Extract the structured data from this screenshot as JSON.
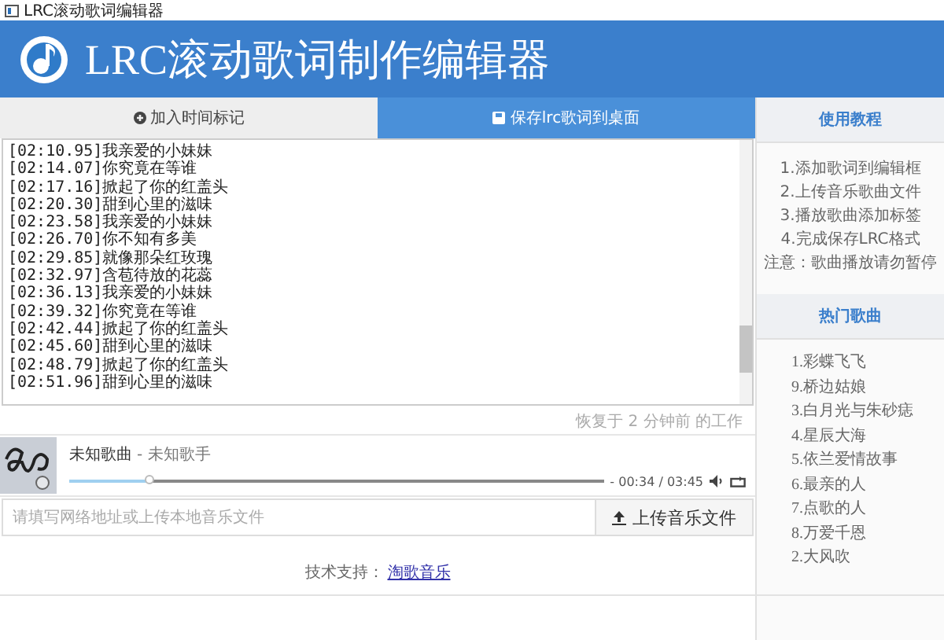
{
  "window": {
    "title": "LRC滚动歌词编辑器"
  },
  "header": {
    "title": "LRC滚动歌词制作编辑器"
  },
  "tabs": [
    {
      "label": "加入时间标记",
      "kind": "add",
      "selected": false
    },
    {
      "label": "保存lrc歌词到桌面",
      "kind": "save",
      "selected": true
    }
  ],
  "lyrics": [
    "[02:10.95]我亲爱的小妹妹",
    "[02:14.07]你究竟在等谁",
    "[02:17.16]掀起了你的红盖头",
    "[02:20.30]甜到心里的滋味",
    "[02:23.58]我亲爱的小妹妹",
    "[02:26.70]你不知有多美",
    "[02:29.85]就像那朵红玫瑰",
    "[02:32.97]含苞待放的花蕊",
    "[02:36.13]我亲爱的小妹妹",
    "[02:39.32]你究竟在等谁",
    "[02:42.44]掀起了你的红盖头",
    "[02:45.60]甜到心里的滋味",
    "[02:48.79]掀起了你的红盖头",
    "[02:51.96]甜到心里的滋味"
  ],
  "restore_note": "恢复于 2 分钟前 的工作",
  "player": {
    "song": "未知歌曲",
    "artist": "- 未知歌手",
    "level": 0.15,
    "time": "- 00:34 / 03:45"
  },
  "upload": {
    "placeholder": "请填写网络地址或上传本地音乐文件",
    "button": "上传音乐文件"
  },
  "footer": {
    "label": "技术支持：",
    "link": "淘歌音乐"
  },
  "sidebar": {
    "tutorial_title": "使用教程",
    "steps": [
      "1.添加歌词到编辑框",
      "2.上传音乐歌曲文件",
      "3.播放歌曲添加标签",
      "4.完成保存LRC格式",
      "注意：歌曲播放请勿暂停"
    ],
    "hot_title": "热门歌曲",
    "songs": [
      "1.彩蝶飞飞",
      "9.桥边姑娘",
      "3.白月光与朱砂痣",
      "4.星辰大海",
      "5.依兰爱情故事",
      "6.最亲的人",
      "7.点歌的人",
      "8.万爱千恩",
      "2.大风吹"
    ]
  }
}
